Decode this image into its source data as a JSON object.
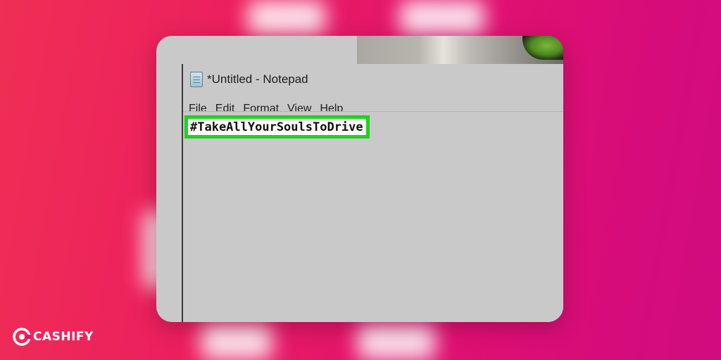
{
  "window": {
    "title": "*Untitled - Notepad",
    "icon": "notepad-icon"
  },
  "menu": {
    "items": [
      {
        "label": "File"
      },
      {
        "label": "Edit"
      },
      {
        "label": "Format"
      },
      {
        "label": "View"
      },
      {
        "label": "Help"
      }
    ]
  },
  "editor": {
    "text": "#TakeAllYourSoulsToDrive",
    "highlight_color": "#22d11f"
  },
  "branding": {
    "logo_text": "CASHIFY",
    "logo_icon": "cashify-logo-icon"
  },
  "colors": {
    "background_start": "#ef2f55",
    "background_end": "#d10c7e",
    "window_gray": "#c9c9c9"
  }
}
